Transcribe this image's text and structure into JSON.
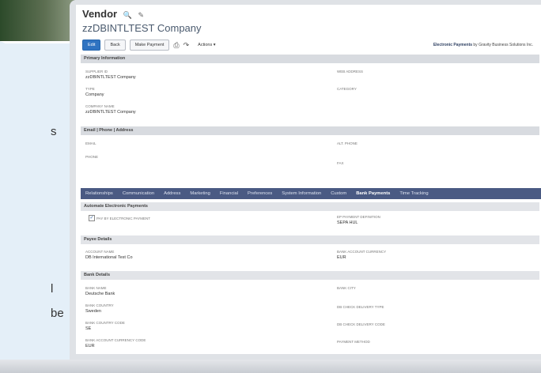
{
  "page": {
    "left_text_fragments": [
      "s",
      "l",
      "be"
    ]
  },
  "app": {
    "record_type": "Vendor",
    "company_name": "zzDBINTLTEST Company",
    "title_icons": [
      "search-icon",
      "edit-icon"
    ]
  },
  "toolbar": {
    "edit_label": "Edit",
    "back_label": "Back",
    "make_payment_label": "Make Payment",
    "print_icon": "print-icon",
    "share_icon": "share-icon",
    "actions_label": "Actions ▾"
  },
  "branding": {
    "prefix": "Electronic Payments",
    "suffix": "by Gravity Business Solutions Inc."
  },
  "sections": {
    "primary": {
      "header": "Primary Information",
      "fields": [
        {
          "label": "SUPPLIER ID",
          "value": "zzDBINTLTEST Company"
        },
        {
          "label": "TYPE",
          "value": "Company"
        },
        {
          "label": "COMPANY NAME",
          "value": "zzDBINTLTEST Company"
        },
        {
          "label": "WEB ADDRESS",
          "value": ""
        },
        {
          "label": "CATEGORY",
          "value": ""
        }
      ]
    },
    "contact": {
      "header": "Email | Phone | Address",
      "fields": [
        {
          "label": "EMAIL",
          "value": ""
        },
        {
          "label": "PHONE",
          "value": ""
        },
        {
          "label": "ALT. PHONE",
          "value": ""
        },
        {
          "label": "FAX",
          "value": ""
        }
      ]
    }
  },
  "tabs": [
    {
      "label": "Relationships",
      "active": false
    },
    {
      "label": "Communication",
      "active": false
    },
    {
      "label": "Address",
      "active": false
    },
    {
      "label": "Marketing",
      "active": false
    },
    {
      "label": "Financial",
      "active": false
    },
    {
      "label": "Preferences",
      "active": false
    },
    {
      "label": "System Information",
      "active": false
    },
    {
      "label": "Custom",
      "active": false
    },
    {
      "label": "Bank Payments",
      "active": true
    },
    {
      "label": "Time Tracking",
      "active": false
    }
  ],
  "bank": {
    "auto_header": "Automate Electronic Payments",
    "checkbox_label": "PAY BY ELECTRONIC PAYMENT",
    "checkbox_checked": true,
    "ep_label": "EP PAYMENT DEFINITION",
    "ep_value": "SEPA HUL",
    "payee_header": "Payee Details",
    "account_name_label": "ACCOUNT NAME",
    "account_name_value": "DB International Test Co",
    "account_currency_label": "BANK ACCOUNT CURRENCY",
    "account_currency_value": "EUR",
    "bank_header": "Bank Details",
    "bank_name_label": "BANK NAME",
    "bank_name_value": "Deutsche Bank",
    "bank_city_label": "BANK CITY",
    "bank_city_value": "",
    "bank_country_label": "BANK COUNTRY",
    "bank_country_value": "Sweden",
    "check_delivery_type_label": "DB CHECK DELIVERY TYPE",
    "check_delivery_type_value": "",
    "country_code_label": "BANK COUNTRY CODE",
    "country_code_value": "SE",
    "check_delivery_code_label": "DB CHECK DELIVERY CODE",
    "check_delivery_code_value": "",
    "account_currency_code_label": "BANK ACCOUNT CURRENCY CODE",
    "account_currency_code_value": "EUR",
    "payment_method_label": "PAYMENT METHOD",
    "payment_method_value": ""
  }
}
